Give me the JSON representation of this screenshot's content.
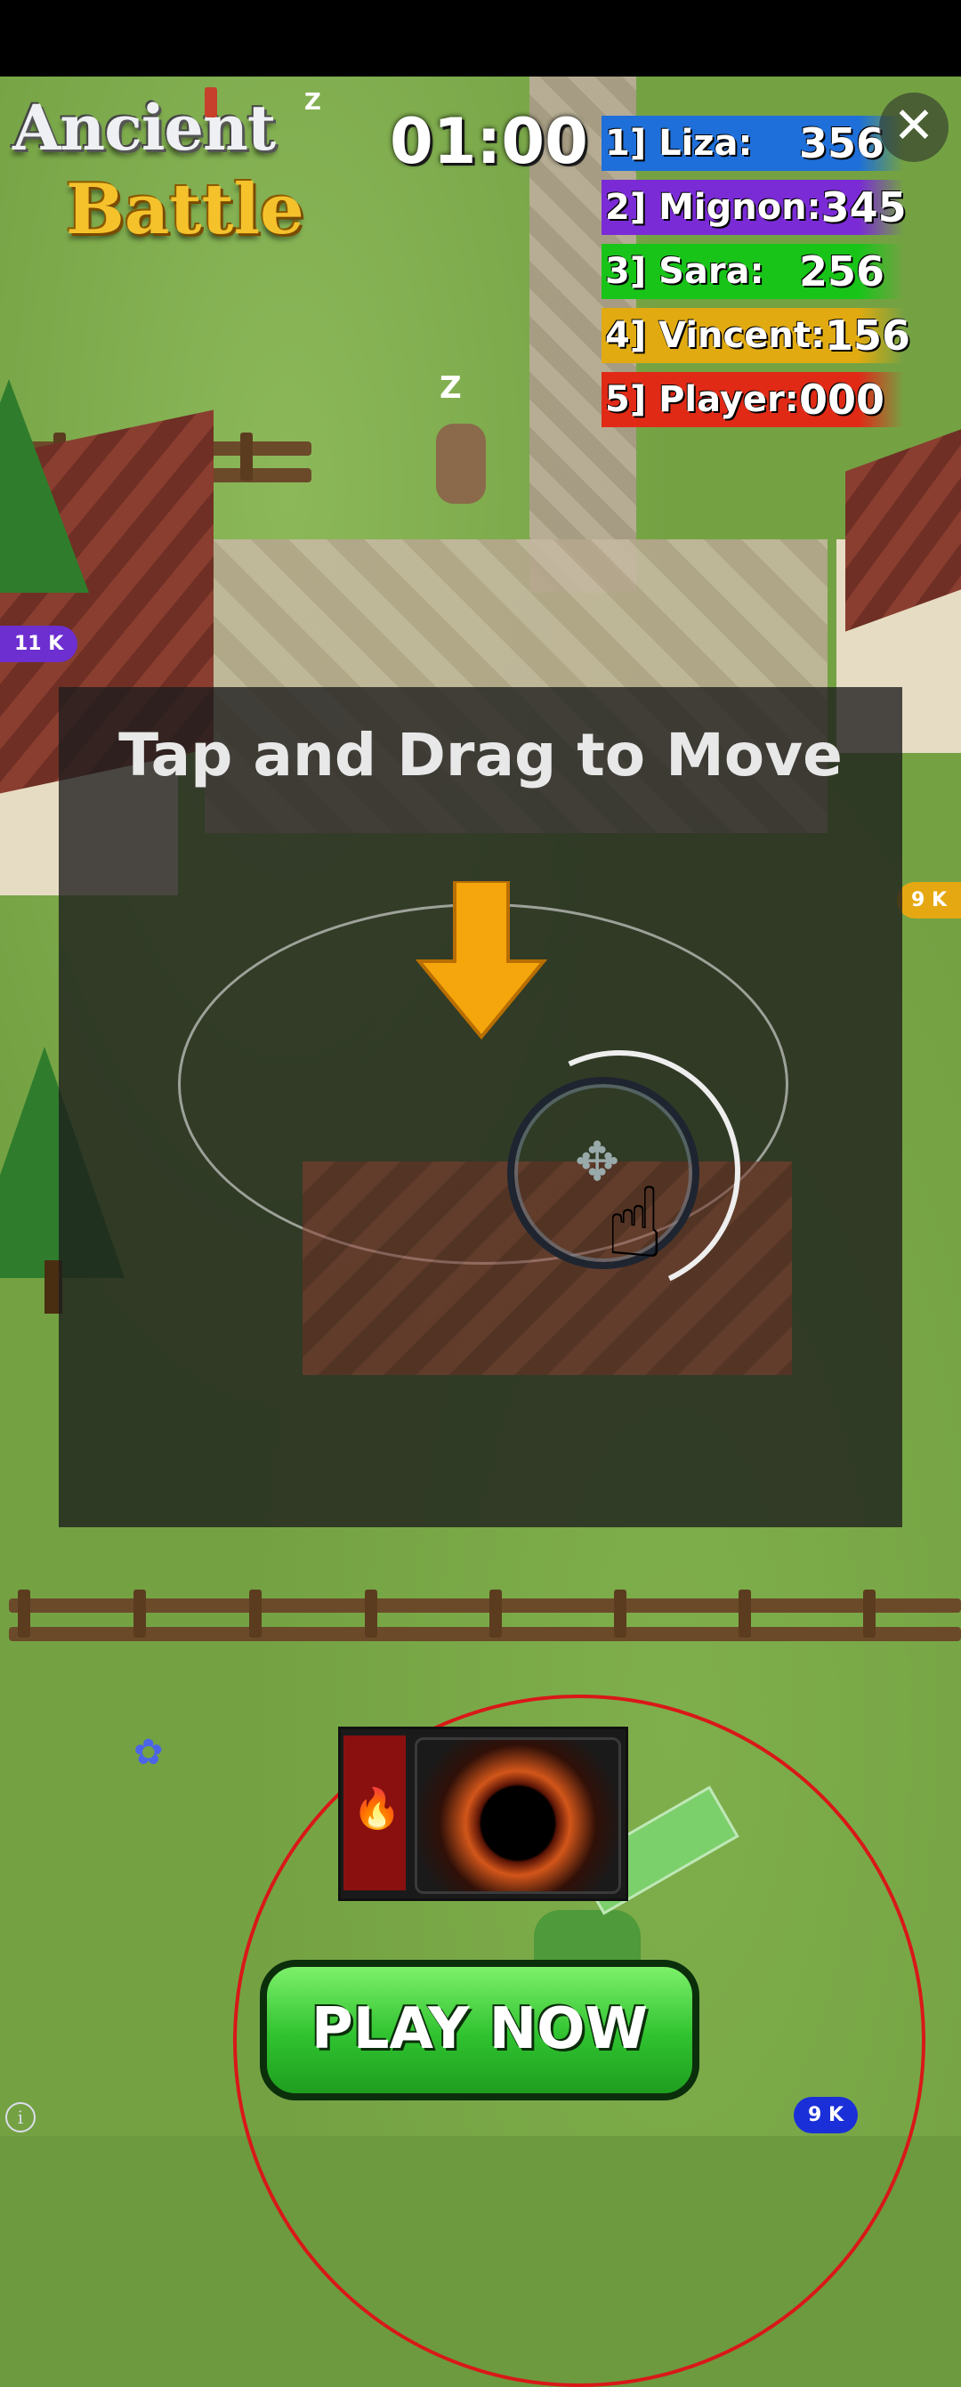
{
  "game": {
    "logo_line1": "Ancient",
    "logo_line2": "Battle",
    "timer": "01:00",
    "close_label": "✕"
  },
  "leaderboard": [
    {
      "rank": "1]",
      "name": "Liza:",
      "score": "356",
      "color": "#1e6fd9"
    },
    {
      "rank": "2]",
      "name": "Mignon:",
      "score": "345",
      "color": "#7a2bd6"
    },
    {
      "rank": "3]",
      "name": "Sara:",
      "score": "256",
      "color": "#19c419"
    },
    {
      "rank": "4]",
      "name": "Vincent:",
      "score": "156",
      "color": "#e0aa10"
    },
    {
      "rank": "5]",
      "name": "Player:",
      "score": "000",
      "color": "#e02a16"
    }
  ],
  "bubbles": {
    "left": "11 K",
    "right": "9 K",
    "bottom": "9 K"
  },
  "tutorial": {
    "text": "Tap and Drag to Move"
  },
  "cta": {
    "play_label": "PLAY NOW"
  },
  "info_label": "i",
  "sleep_label": "Z"
}
